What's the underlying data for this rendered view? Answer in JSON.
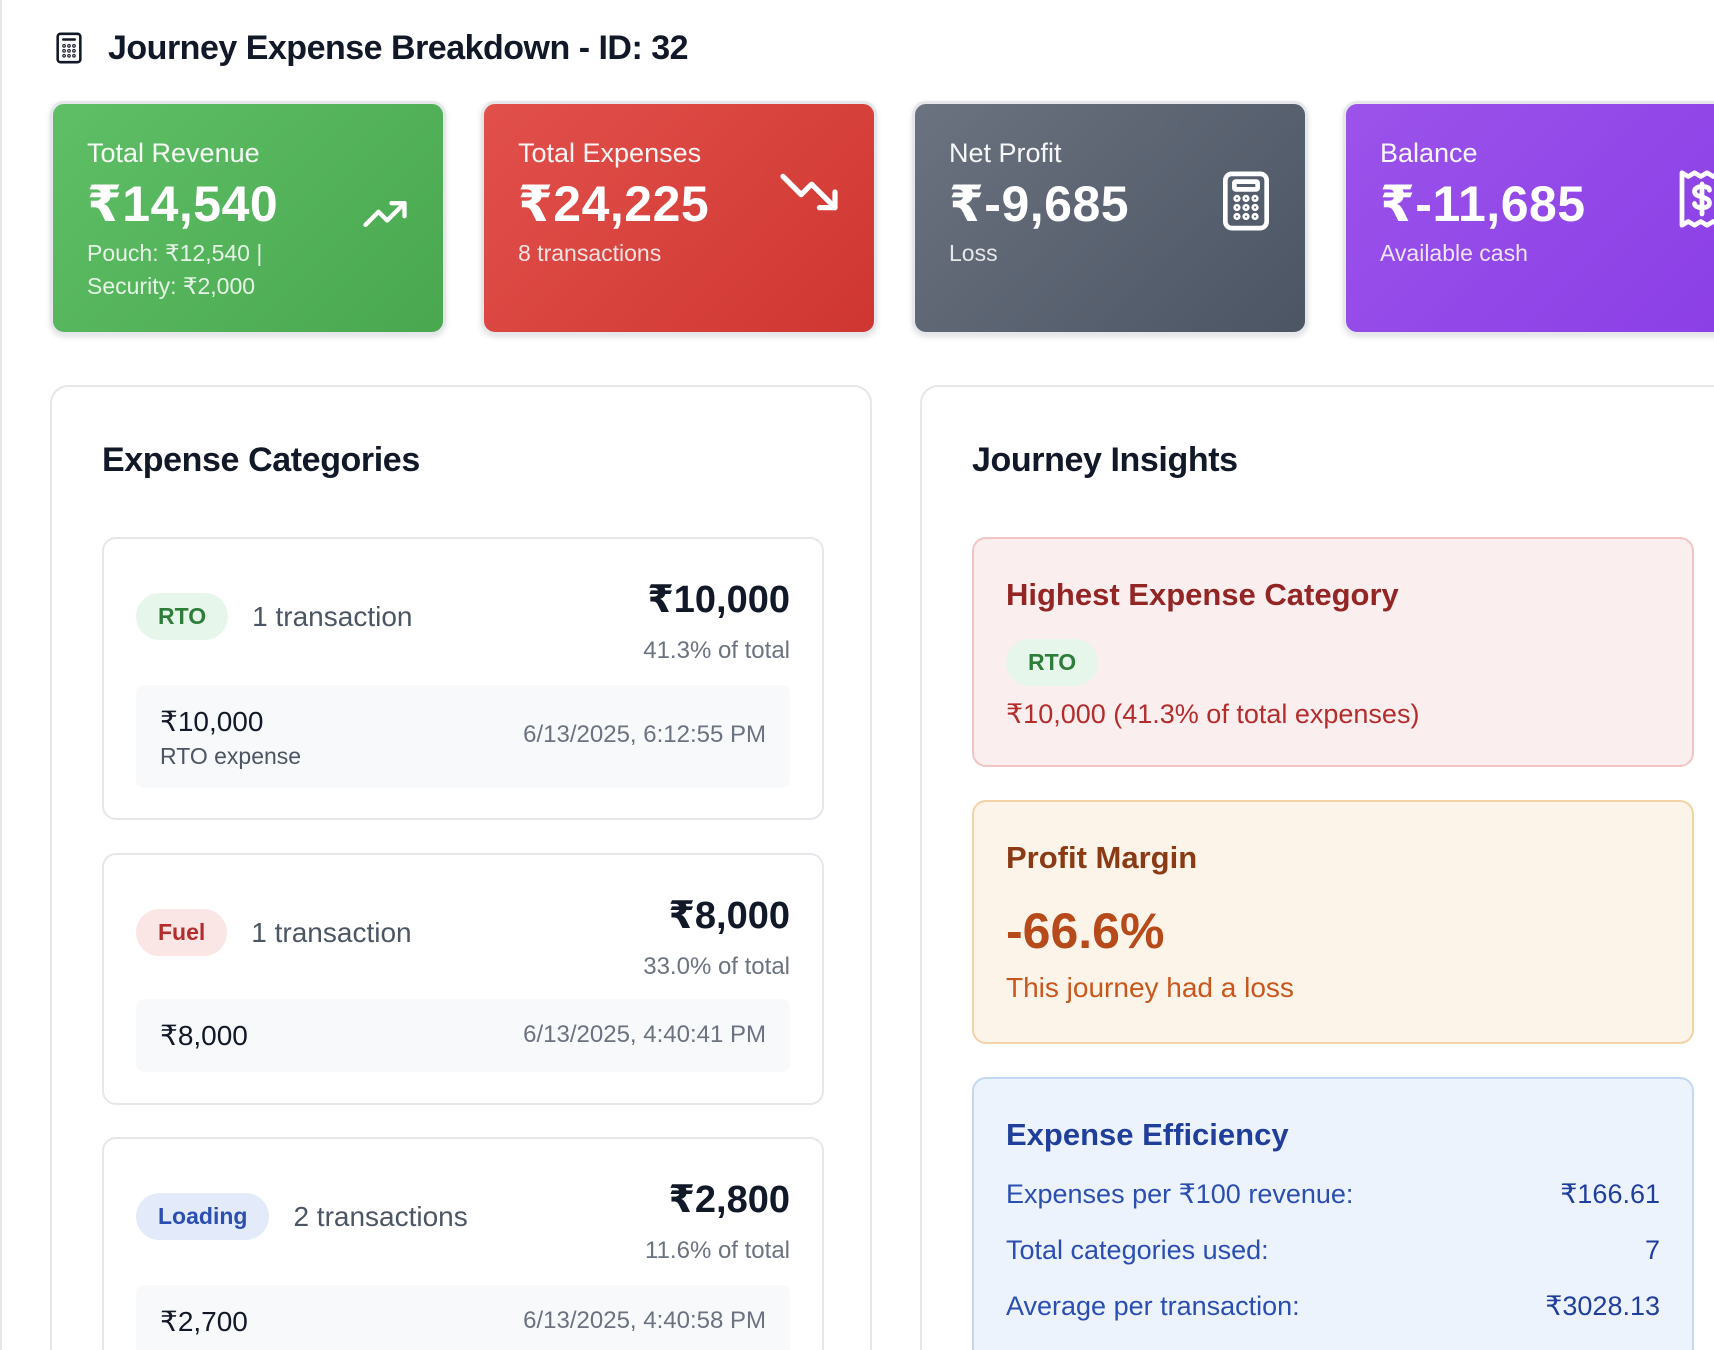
{
  "header": {
    "title": "Journey Expense Breakdown - ID: 32",
    "icon": "calculator-icon"
  },
  "stats": {
    "revenue": {
      "label": "Total Revenue",
      "value": "₹14,540",
      "sub1": "Pouch: ₹12,540 |",
      "sub2": "Security: ₹2,000",
      "icon": "trending-up-icon",
      "color": "#4caf50"
    },
    "expenses": {
      "label": "Total Expenses",
      "value": "₹24,225",
      "sub": "8 transactions",
      "icon": "trending-down-icon",
      "color": "#d9413c"
    },
    "profit": {
      "label": "Net Profit",
      "value": "₹-9,685",
      "sub": "Loss",
      "icon": "calculator-icon",
      "color": "#5b6270"
    },
    "balance": {
      "label": "Balance",
      "value": "₹-11,685",
      "sub": "Available cash",
      "icon": "receipt-icon",
      "color": "#9146e8"
    }
  },
  "categories": {
    "title": "Expense Categories",
    "items": [
      {
        "tag": "RTO",
        "count": "1 transaction",
        "amount": "₹10,000",
        "pct": "41.3% of total",
        "tx": {
          "amount": "₹10,000",
          "note": "RTO expense",
          "date": "6/13/2025, 6:12:55 PM"
        }
      },
      {
        "tag": "Fuel",
        "count": "1 transaction",
        "amount": "₹8,000",
        "pct": "33.0% of total",
        "tx": {
          "amount": "₹8,000",
          "date": "6/13/2025, 4:40:41 PM"
        }
      },
      {
        "tag": "Loading",
        "count": "2 transactions",
        "amount": "₹2,800",
        "pct": "11.6% of total",
        "tx": {
          "amount": "₹2,700",
          "date": "6/13/2025, 4:40:58 PM"
        }
      }
    ]
  },
  "insights": {
    "title": "Journey Insights",
    "highest": {
      "title": "Highest Expense Category",
      "tag": "RTO",
      "text": "₹10,000 (41.3% of total expenses)"
    },
    "margin": {
      "title": "Profit Margin",
      "value": "-66.6%",
      "note": "This journey had a loss"
    },
    "efficiency": {
      "title": "Expense Efficiency",
      "rows": [
        {
          "label": "Expenses per ₹100 revenue:",
          "value": "₹166.61"
        },
        {
          "label": "Total categories used:",
          "value": "7"
        },
        {
          "label": "Average per transaction:",
          "value": "₹3028.13"
        }
      ]
    }
  }
}
